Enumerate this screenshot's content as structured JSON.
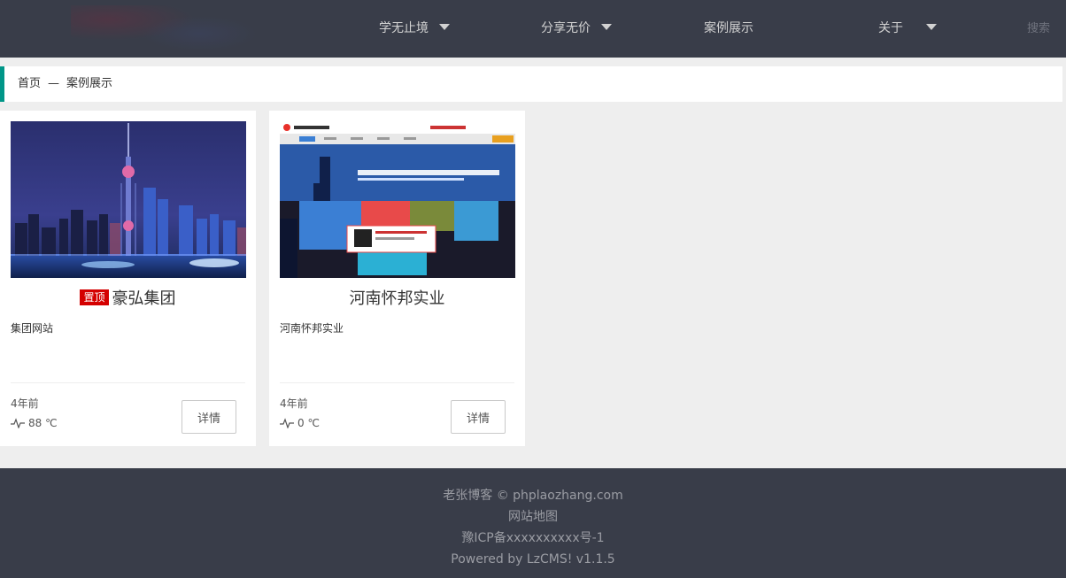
{
  "header": {
    "nav": [
      {
        "label": "学无止境",
        "has_dropdown": true
      },
      {
        "label": "分享无价",
        "has_dropdown": true
      },
      {
        "label": "案例展示",
        "has_dropdown": false
      },
      {
        "label": "关于",
        "has_dropdown": true
      }
    ],
    "search_label": "搜索"
  },
  "breadcrumb": {
    "home": "首页",
    "separator": "—",
    "current": "案例展示"
  },
  "cards": [
    {
      "badge": "置顶",
      "title": "豪弘集团",
      "description": "集团网站",
      "time": "4年前",
      "heat": "88 ℃",
      "button": "详情"
    },
    {
      "title": "河南怀邦实业",
      "description": "河南怀邦实业",
      "time": "4年前",
      "heat": "0 ℃",
      "button": "详情"
    }
  ],
  "footer": {
    "copyright": "老张博客 ©  phplaozhang.com",
    "sitemap": "网站地图",
    "icp": "豫ICP备xxxxxxxxxx号-1",
    "powered": "Powered by LzCMS! v1.1.5"
  },
  "colors": {
    "header_bg": "#393d49",
    "accent": "#009688",
    "badge": "#d40000"
  }
}
